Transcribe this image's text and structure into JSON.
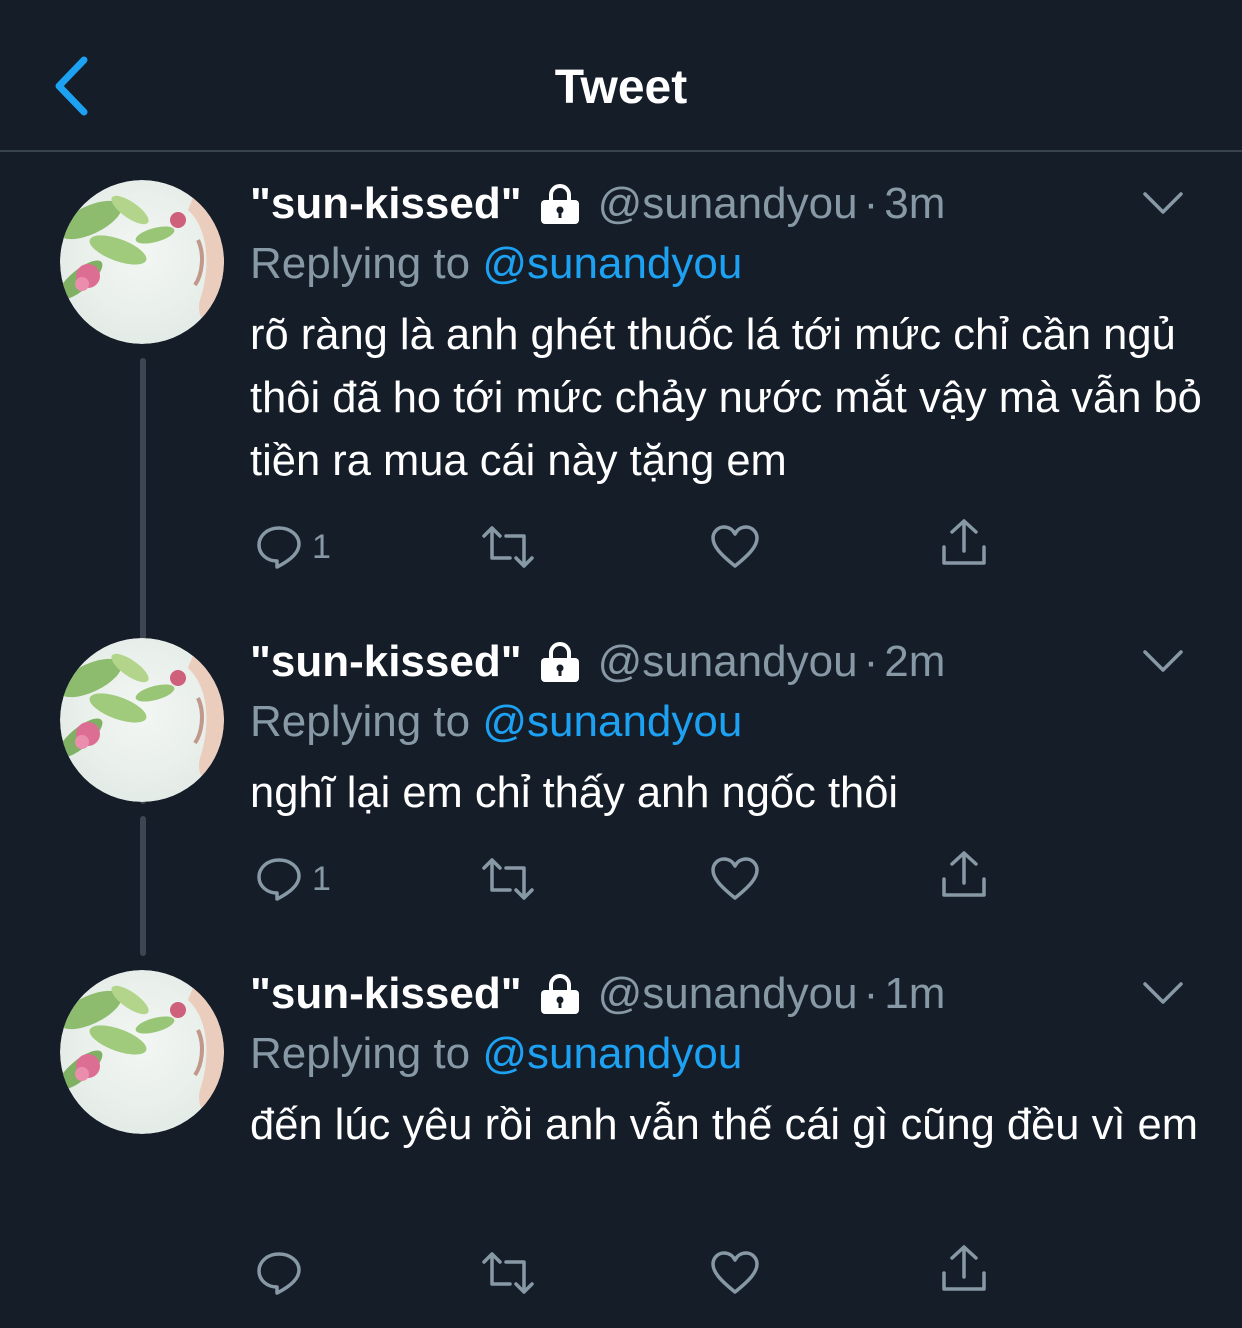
{
  "header": {
    "back_icon": "chevron-left-icon",
    "title": "Tweet"
  },
  "colors": {
    "background": "#151d29",
    "accent": "#1da1f2",
    "secondary_text": "#8899a6",
    "divider": "#38444d"
  },
  "tweets": [
    {
      "display_name": "\"sun-kissed\"",
      "protected_icon": "lock-icon",
      "handle": "@sunandyou",
      "separator": "·",
      "time": "3m",
      "replying_prefix": "Replying to",
      "replying_to": "@sunandyou",
      "text": "rõ ràng là anh ghét thuốc lá tới mức chỉ cần ngủ thôi đã ho tới mức chảy nước mắt vậy mà vẫn bỏ tiền ra mua cái này tặng em",
      "reply_count": "1"
    },
    {
      "display_name": "\"sun-kissed\"",
      "protected_icon": "lock-icon",
      "handle": "@sunandyou",
      "separator": "·",
      "time": "2m",
      "replying_prefix": "Replying to",
      "replying_to": "@sunandyou",
      "text": "nghĩ lại em chỉ thấy anh ngốc thôi",
      "reply_count": "1"
    },
    {
      "display_name": "\"sun-kissed\"",
      "protected_icon": "lock-icon",
      "handle": "@sunandyou",
      "separator": "·",
      "time": "1m",
      "replying_prefix": "Replying to",
      "replying_to": "@sunandyou",
      "text": "đến lúc yêu rồi anh vẫn thế cái gì cũng đều vì em",
      "reply_count": ""
    }
  ]
}
